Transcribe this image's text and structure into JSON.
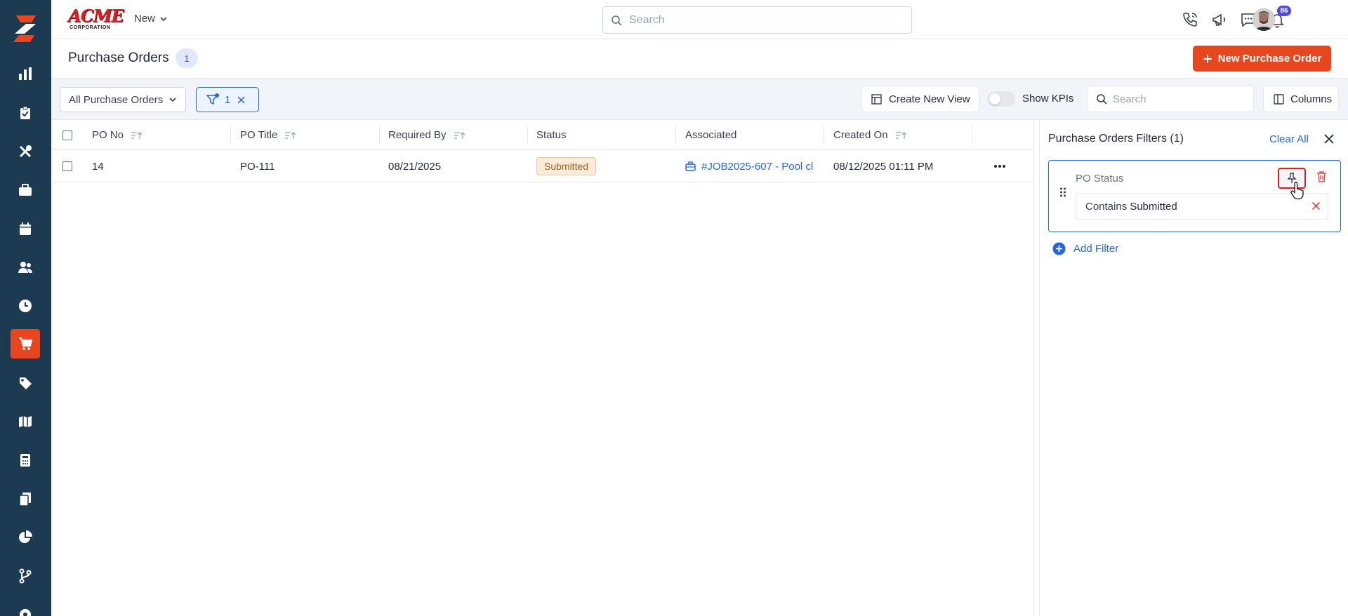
{
  "brand": {
    "name": "ACME",
    "sub": "CORPORATION"
  },
  "topbar": {
    "new_label": "New",
    "search_placeholder": "Search",
    "notification_count": "86"
  },
  "page": {
    "title": "Purchase Orders",
    "count": "1",
    "new_button_label": "New Purchase Order"
  },
  "toolbar": {
    "view_select": "All Purchase Orders",
    "filter_count": "1",
    "create_view_label": "Create New View",
    "show_kpis_label": "Show KPIs",
    "show_kpis_on": false,
    "search_placeholder": "Search",
    "columns_label": "Columns"
  },
  "table": {
    "columns": [
      "PO No",
      "PO Title",
      "Required By",
      "Status",
      "Associated",
      "Created On"
    ],
    "rows": [
      {
        "po_no": "14",
        "po_title": "PO-111",
        "required_by": "08/21/2025",
        "status": "Submitted",
        "associated": "#JOB2025-607 - Pool cl",
        "created_on": "08/12/2025 01:11 PM"
      }
    ]
  },
  "filters_panel": {
    "title": "Purchase Orders Filters (1)",
    "clear_all": "Clear All",
    "filters": [
      {
        "field": "PO Status",
        "operator": "Contains",
        "value": "Submitted"
      }
    ],
    "add_filter_label": "Add Filter"
  },
  "colors": {
    "sidebar": "#1c3a52",
    "accent": "#e8461f",
    "link": "#2563eb",
    "status_submitted_bg": "#fbecd9",
    "status_submitted_text": "#a35d1c"
  },
  "icons": {
    "sidebar": [
      "reports-icon",
      "clipboard-icon",
      "tools-icon",
      "briefcase-icon",
      "calendar-icon",
      "users-icon",
      "clock-icon",
      "cart-icon",
      "tag-icon",
      "map-icon",
      "calculator-icon",
      "documents-icon",
      "pie-chart-icon",
      "branch-icon",
      "settings-icon"
    ],
    "topbar": [
      "phone-icon",
      "megaphone-icon",
      "chat-icon",
      "bell-icon"
    ]
  }
}
